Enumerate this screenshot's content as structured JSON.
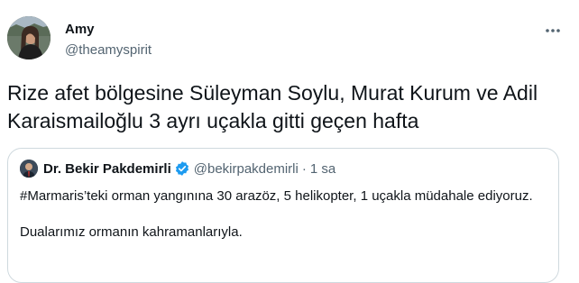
{
  "author": {
    "display_name": "Amy",
    "handle": "@theamyspirit"
  },
  "more_icon": "ellipsis-icon",
  "tweet": {
    "text": "Rize afet bölgesine Süleyman Soylu, Murat Kurum ve Adil Karaismailoğlu 3 ayrı uçakla gitti geçen hafta"
  },
  "quoted": {
    "display_name": "Dr. Bekir Pakdemirli",
    "verified_icon": "verified-badge-icon",
    "handle": "@bekirpakdemirli",
    "separator": "·",
    "time": "1 sa",
    "paragraph1": "#Marmaris’teki orman yangınına 30 arazöz, 5 helikopter, 1 uçakla müdahale ediyoruz.",
    "paragraph2": "Dualarımız ormanın kahramanlarıyla."
  },
  "colors": {
    "text": "#0f1419",
    "secondary": "#536471",
    "border": "#cfd9de",
    "verified": "#1d9bf0"
  }
}
